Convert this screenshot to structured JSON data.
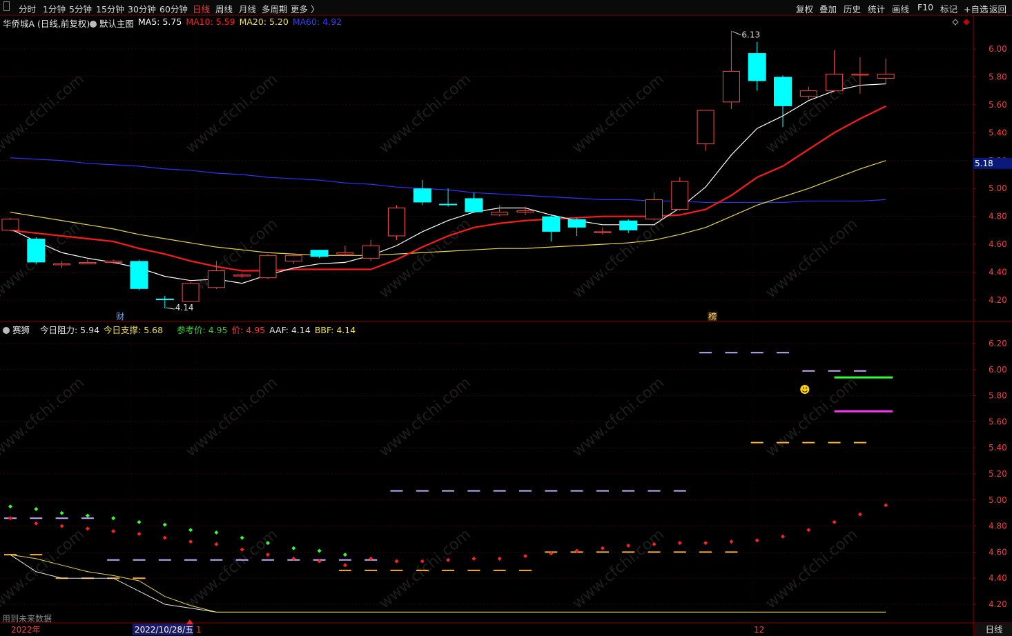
{
  "toolbar": {
    "periods": [
      "分时",
      "1分钟",
      "5分钟",
      "15分钟",
      "30分钟",
      "60分钟",
      "日线",
      "周线",
      "月线",
      "多周期",
      "更多 〉"
    ],
    "active_period": "日线",
    "tools": [
      "复权",
      "叠加",
      "历史",
      "统计",
      "画线",
      "F10",
      "标记",
      "+自选",
      "返回"
    ]
  },
  "main_panel": {
    "stock_name": "华侨城A (日线,前复权)",
    "template": "默认主图",
    "ma_labels": [
      {
        "label": "MA5: 5.75",
        "color": "#ffffff"
      },
      {
        "label": "MA10: 5.59",
        "color": "#ff2020"
      },
      {
        "label": "MA20: 5.20",
        "color": "#f0e040"
      },
      {
        "label": "MA60: 4.92",
        "color": "#3040ff"
      }
    ],
    "y_ticks": [
      "6.00",
      "5.80",
      "5.60",
      "5.40",
      "5.20",
      "5.00",
      "4.80",
      "4.60",
      "4.40",
      "4.20"
    ],
    "y_tick_values": [
      6.0,
      5.8,
      5.6,
      5.4,
      5.2,
      5.0,
      4.8,
      4.6,
      4.4,
      4.2
    ],
    "current_price_tag": "5.18",
    "high_label": "6.13",
    "low_label": "4.14",
    "event_markers": [
      "财",
      "榜"
    ]
  },
  "indicator_panel": {
    "name": "赛狮",
    "labels": [
      {
        "label": "今日阻力: 5.94",
        "color": "#e0e0e0"
      },
      {
        "label": "今日支撑: 5.68",
        "color": "#f0e040"
      },
      {
        "label": "参考价: 4.95",
        "color": "#30d030"
      },
      {
        "label": "价: 4.95",
        "color": "#ff3030"
      },
      {
        "label": "AAF: 4.14",
        "color": "#e0e0e0"
      },
      {
        "label": "BBF: 4.14",
        "color": "#f0e040"
      }
    ],
    "y_ticks": [
      "6.20",
      "6.00",
      "5.80",
      "5.60",
      "5.40",
      "5.20",
      "5.00",
      "4.80",
      "4.60",
      "4.40",
      "4.20"
    ],
    "y_tick_values": [
      6.2,
      6.0,
      5.8,
      5.6,
      5.4,
      5.2,
      5.0,
      4.8,
      4.6,
      4.4,
      4.2
    ],
    "note": "用到未来数据",
    "emoji": "☻"
  },
  "time_axis": {
    "labels": [
      "2022年",
      "2022/10/28/五",
      "1",
      "12"
    ],
    "period_tab": "日线"
  },
  "chart_data": {
    "type": "candlestick",
    "candles": [
      {
        "o": 4.7,
        "c": 4.78,
        "h": 4.79,
        "l": 4.7
      },
      {
        "o": 4.64,
        "c": 4.47,
        "h": 4.65,
        "l": 4.46
      },
      {
        "o": 4.46,
        "c": 4.46,
        "h": 4.48,
        "l": 4.43
      },
      {
        "o": 4.46,
        "c": 4.47,
        "h": 4.49,
        "l": 4.46
      },
      {
        "o": 4.47,
        "c": 4.48,
        "h": 4.49,
        "l": 4.46
      },
      {
        "o": 4.48,
        "c": 4.28,
        "h": 4.49,
        "l": 4.27
      },
      {
        "o": 4.21,
        "c": 4.2,
        "h": 4.23,
        "l": 4.14
      },
      {
        "o": 4.19,
        "c": 4.32,
        "h": 4.33,
        "l": 4.19
      },
      {
        "o": 4.29,
        "c": 4.41,
        "h": 4.48,
        "l": 4.28
      },
      {
        "o": 4.38,
        "c": 4.38,
        "h": 4.39,
        "l": 4.36
      },
      {
        "o": 4.36,
        "c": 4.52,
        "h": 4.53,
        "l": 4.35
      },
      {
        "o": 4.48,
        "c": 4.52,
        "h": 4.53,
        "l": 4.46
      },
      {
        "o": 4.56,
        "c": 4.51,
        "h": 4.56,
        "l": 4.5
      },
      {
        "o": 4.53,
        "c": 4.54,
        "h": 4.59,
        "l": 4.52
      },
      {
        "o": 4.5,
        "c": 4.59,
        "h": 4.63,
        "l": 4.48
      },
      {
        "o": 4.66,
        "c": 4.86,
        "h": 4.88,
        "l": 4.63
      },
      {
        "o": 5.0,
        "c": 4.9,
        "h": 5.06,
        "l": 4.88
      },
      {
        "o": 4.89,
        "c": 4.88,
        "h": 5.0,
        "l": 4.87
      },
      {
        "o": 4.93,
        "c": 4.83,
        "h": 4.97,
        "l": 4.83
      },
      {
        "o": 4.81,
        "c": 4.83,
        "h": 4.88,
        "l": 4.8
      },
      {
        "o": 4.83,
        "c": 4.84,
        "h": 4.87,
        "l": 4.81
      },
      {
        "o": 4.8,
        "c": 4.69,
        "h": 4.81,
        "l": 4.62
      },
      {
        "o": 4.78,
        "c": 4.72,
        "h": 4.79,
        "l": 4.66
      },
      {
        "o": 4.69,
        "c": 4.69,
        "h": 4.72,
        "l": 4.67
      },
      {
        "o": 4.77,
        "c": 4.7,
        "h": 4.78,
        "l": 4.68
      },
      {
        "o": 4.78,
        "c": 4.92,
        "h": 4.97,
        "l": 4.77
      },
      {
        "o": 4.85,
        "c": 5.05,
        "h": 5.08,
        "l": 4.84
      },
      {
        "o": 5.32,
        "c": 5.56,
        "h": 5.56,
        "l": 5.27
      },
      {
        "o": 5.62,
        "c": 5.84,
        "h": 6.13,
        "l": 5.57
      },
      {
        "o": 5.97,
        "c": 5.77,
        "h": 6.05,
        "l": 5.7
      },
      {
        "o": 5.8,
        "c": 5.59,
        "h": 5.81,
        "l": 5.44
      },
      {
        "o": 5.66,
        "c": 5.7,
        "h": 5.73,
        "l": 5.64
      },
      {
        "o": 5.7,
        "c": 5.82,
        "h": 5.99,
        "l": 5.69
      },
      {
        "o": 5.82,
        "c": 5.82,
        "h": 5.94,
        "l": 5.68
      },
      {
        "o": 5.79,
        "c": 5.82,
        "h": 5.93,
        "l": 5.75
      }
    ],
    "ma5": [
      4.71,
      4.62,
      4.54,
      4.5,
      4.47,
      4.43,
      4.37,
      4.34,
      4.35,
      4.32,
      4.38,
      4.43,
      4.46,
      4.47,
      4.52,
      4.59,
      4.69,
      4.77,
      4.83,
      4.86,
      4.86,
      4.81,
      4.77,
      4.74,
      4.74,
      4.74,
      4.86,
      5.01,
      5.24,
      5.43,
      5.52,
      5.63,
      5.7,
      5.74,
      5.75
    ],
    "ma10": [
      4.7,
      4.68,
      4.66,
      4.64,
      4.62,
      4.57,
      4.53,
      4.48,
      4.44,
      4.41,
      4.41,
      4.42,
      4.42,
      4.42,
      4.42,
      4.49,
      4.58,
      4.66,
      4.72,
      4.75,
      4.77,
      4.78,
      4.79,
      4.8,
      4.8,
      4.8,
      4.81,
      4.85,
      4.95,
      5.08,
      5.16,
      5.28,
      5.4,
      5.5,
      5.59
    ],
    "ma20": [
      4.83,
      4.8,
      4.77,
      4.74,
      4.71,
      4.67,
      4.64,
      4.61,
      4.58,
      4.56,
      4.54,
      4.53,
      4.52,
      4.52,
      4.52,
      4.53,
      4.54,
      4.55,
      4.56,
      4.57,
      4.57,
      4.58,
      4.59,
      4.6,
      4.61,
      4.63,
      4.67,
      4.72,
      4.8,
      4.88,
      4.94,
      5.0,
      5.07,
      5.14,
      5.2
    ],
    "ma60": [
      5.22,
      5.21,
      5.2,
      5.18,
      5.17,
      5.16,
      5.14,
      5.13,
      5.11,
      5.1,
      5.08,
      5.07,
      5.06,
      5.04,
      5.03,
      5.01,
      5.0,
      4.99,
      4.97,
      4.96,
      4.95,
      4.94,
      4.93,
      4.92,
      4.92,
      4.91,
      4.91,
      4.9,
      4.9,
      4.9,
      4.9,
      4.91,
      4.91,
      4.91,
      4.92
    ],
    "indicator": {
      "green_dots": [
        4.95,
        4.93,
        4.9,
        4.88,
        4.86,
        4.83,
        4.81,
        4.77,
        4.75,
        4.71,
        4.67,
        4.63,
        4.61,
        4.58
      ],
      "red_dots": [
        4.86,
        4.82,
        4.8,
        4.78,
        4.76,
        4.74,
        4.71,
        4.68,
        4.66,
        4.62,
        4.58,
        4.55,
        4.53,
        4.5,
        4.55,
        4.53,
        4.53,
        4.54,
        4.55,
        4.55,
        4.57,
        4.59,
        4.61,
        4.63,
        4.65,
        4.66,
        4.67,
        4.67,
        4.68,
        4.69,
        4.72,
        4.77,
        4.83,
        4.89,
        4.96
      ],
      "lavender_dashes": [
        {
          "from": 0,
          "to": 3,
          "y": 4.86
        },
        {
          "from": 4,
          "to": 14,
          "y": 4.54
        },
        {
          "from": 15,
          "to": 26,
          "y": 5.07
        },
        {
          "from": 27,
          "to": 30,
          "y": 6.13
        },
        {
          "from": 31,
          "to": 33,
          "y": 5.99
        }
      ],
      "orange_dashes": [
        {
          "from": 0,
          "to": 1,
          "y": 4.58
        },
        {
          "from": 2,
          "to": 5,
          "y": 4.4
        },
        {
          "from": 13,
          "to": 20,
          "y": 4.46
        },
        {
          "from": 21,
          "to": 28,
          "y": 4.6
        },
        {
          "from": 29,
          "to": 33,
          "y": 5.44
        }
      ],
      "resistance_line": {
        "from": 32,
        "to": 34,
        "y": 5.94
      },
      "support_line": {
        "from": 32,
        "to": 34,
        "y": 5.68
      },
      "aaf": [
        4.58,
        4.45,
        4.4,
        4.4,
        4.4,
        4.3,
        4.2,
        4.17,
        4.14,
        4.14,
        4.14,
        4.14,
        4.14,
        4.14,
        4.14,
        4.14,
        4.14,
        4.14,
        4.14,
        4.14,
        4.14,
        4.14,
        4.14,
        4.14,
        4.14,
        4.14,
        4.14,
        4.14,
        4.14,
        4.14,
        4.14,
        4.14,
        4.14,
        4.14,
        4.14
      ],
      "bbf": [
        4.58,
        4.55,
        4.5,
        4.45,
        4.42,
        4.38,
        4.26,
        4.19,
        4.14,
        4.14,
        4.14,
        4.14,
        4.14,
        4.14,
        4.14,
        4.14,
        4.14,
        4.14,
        4.14,
        4.14,
        4.14,
        4.14,
        4.14,
        4.14,
        4.14,
        4.14,
        4.14,
        4.14,
        4.14,
        4.14,
        4.14,
        4.14,
        4.14,
        4.14,
        4.14
      ]
    }
  }
}
